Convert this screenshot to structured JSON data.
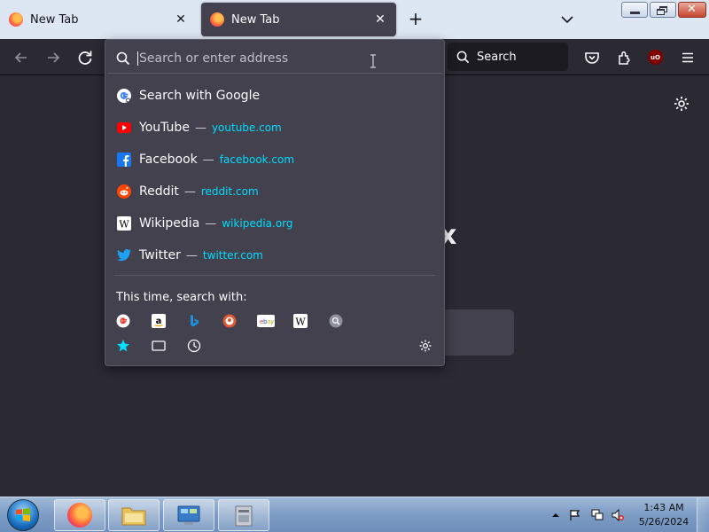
{
  "tabs": [
    {
      "label": "New Tab",
      "active": false
    },
    {
      "label": "New Tab",
      "active": true
    }
  ],
  "toolbar": {
    "search_label": "Search",
    "ublock_badge": "uO"
  },
  "urlbar": {
    "placeholder": "Search or enter address"
  },
  "suggestions": {
    "search_with": "Search with Google",
    "sites": [
      {
        "title": "YouTube",
        "url": "youtube.com",
        "icon": "youtube-icon"
      },
      {
        "title": "Facebook",
        "url": "facebook.com",
        "icon": "facebook-icon"
      },
      {
        "title": "Reddit",
        "url": "reddit.com",
        "icon": "reddit-icon"
      },
      {
        "title": "Wikipedia",
        "url": "wikipedia.org",
        "icon": "wikipedia-icon"
      },
      {
        "title": "Twitter",
        "url": "twitter.com",
        "icon": "twitter-icon"
      }
    ],
    "separator": "—"
  },
  "engines": {
    "label": "This time, search with:",
    "list": [
      "google-icon",
      "amazon-icon",
      "bing-icon",
      "duckduckgo-icon",
      "ebay-icon",
      "wikipedia-icon",
      "search-engine-icon"
    ],
    "modes": [
      "bookmarks-star-icon",
      "tabs-icon",
      "history-clock-icon"
    ]
  },
  "page": {
    "logo_fragment": "x"
  },
  "taskbar": {
    "time": "1:43 AM",
    "date": "5/26/2024"
  },
  "colors": {
    "accent_url": "#00ddff",
    "panel_bg": "#42414d",
    "toolbar_bg": "#2b2a33",
    "tabstrip_bg": "#dde6f3"
  }
}
